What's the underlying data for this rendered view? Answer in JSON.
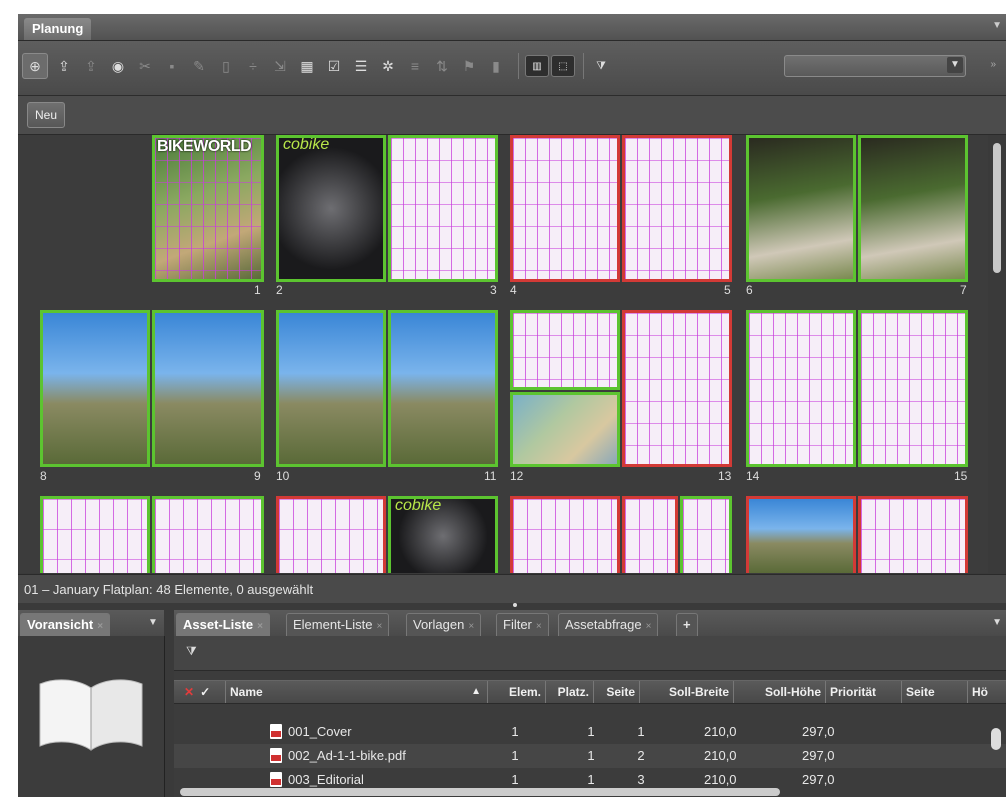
{
  "window": {
    "title": "Planung"
  },
  "toolbar": {
    "icons": [
      "add-icon",
      "upload-icon",
      "upload-alt-icon",
      "preview-icon",
      "cut-icon",
      "save-icon",
      "edit-icon",
      "trash-icon",
      "divide-icon",
      "merge-icon",
      "calculator-icon",
      "checklist-icon",
      "list-icon",
      "settings-icon",
      "align-icon",
      "sort-icon",
      "flag-icon",
      "chart-icon"
    ],
    "view_toggles": [
      "spread-view-icon",
      "grid-view-icon"
    ],
    "filter_select": {
      "value": ""
    }
  },
  "subbar": {
    "new_label": "Neu"
  },
  "flatplan": {
    "page_numbers": [
      "1",
      "2",
      "3",
      "4",
      "5",
      "6",
      "7",
      "8",
      "9",
      "10",
      "11",
      "12",
      "13",
      "14",
      "15"
    ],
    "cover_title": "BIKEWORLD",
    "brand": "cobike"
  },
  "status": {
    "text": "01 – January Flatplan: 48 Elemente, 0 ausgewählt"
  },
  "panels": {
    "left_tab": "Voransicht",
    "tabs": [
      "Asset-Liste",
      "Element-Liste",
      "Vorlagen",
      "Filter",
      "Assetabfrage"
    ],
    "add_label": "+"
  },
  "table": {
    "columns": [
      "Name",
      "Elem.",
      "Platz.",
      "Seite",
      "Soll-Breite",
      "Soll-Höhe",
      "Priorität",
      "Seite",
      "Hö"
    ],
    "rows": [
      {
        "name": "001_Cover",
        "elem": "1",
        "platz": "1",
        "seite": "1",
        "breite": "210,0",
        "hoehe": "297,0"
      },
      {
        "name": "002_Ad-1-1-bike.pdf",
        "elem": "1",
        "platz": "1",
        "seite": "2",
        "breite": "210,0",
        "hoehe": "297,0"
      },
      {
        "name": "003_Editorial",
        "elem": "1",
        "platz": "1",
        "seite": "3",
        "breite": "210,0",
        "hoehe": "297,0"
      }
    ]
  },
  "colors": {
    "placed": "#5cc430",
    "unplaced": "#d23a36",
    "grid": "#c83cdc"
  }
}
